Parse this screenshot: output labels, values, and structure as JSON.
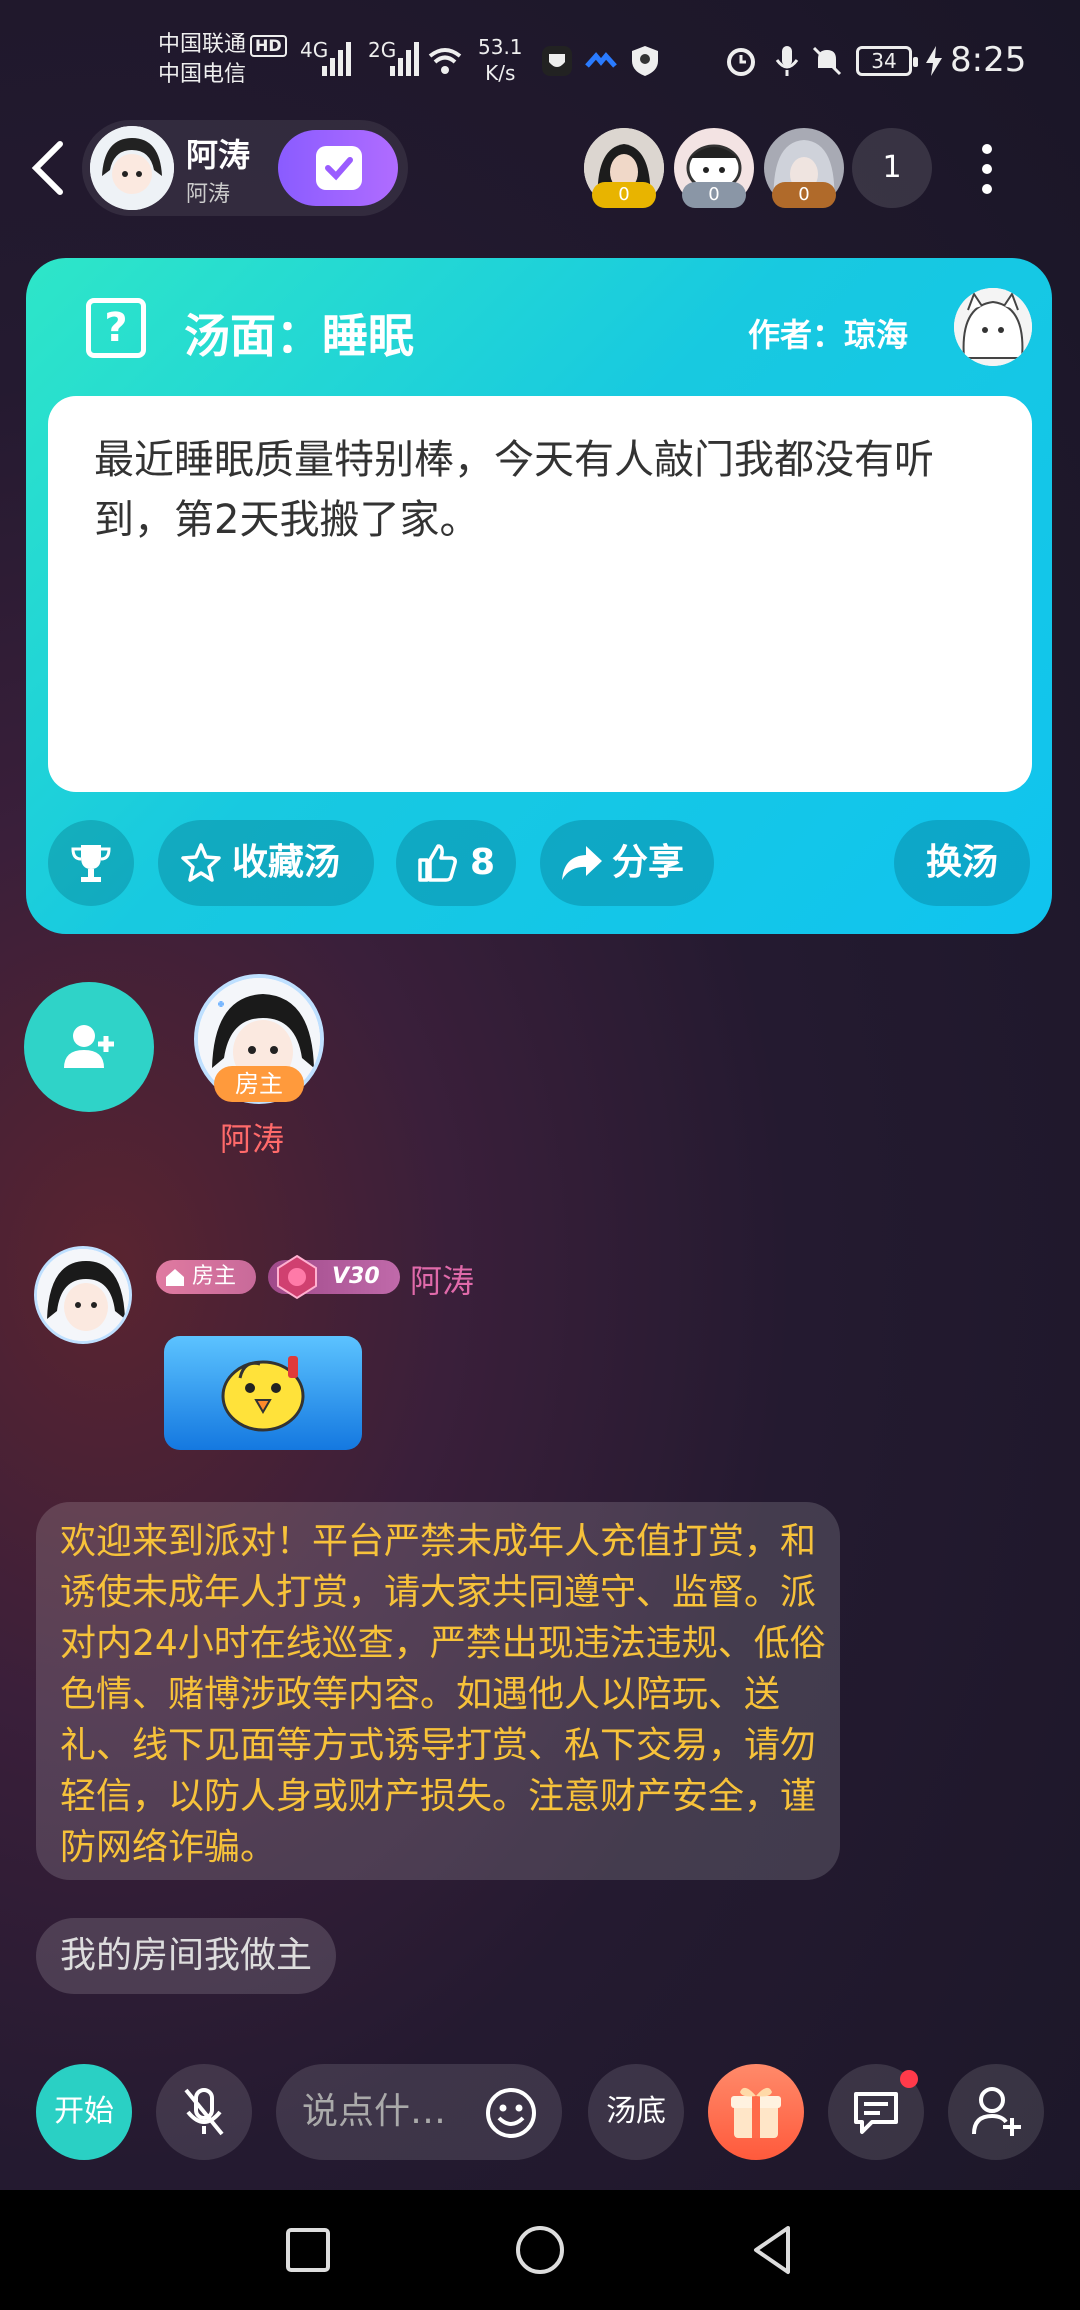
{
  "status_bar": {
    "carrier1": "中国联通",
    "carrier1_badge": "HD",
    "carrier2": "中国电信",
    "sig1": "4G",
    "sig2": "2G",
    "net_speed_value": "53.1",
    "net_speed_unit": "K/s",
    "battery": "34",
    "time": "8:25"
  },
  "header": {
    "host_name": "阿涛",
    "host_sub": "阿涛",
    "viewer_badges": [
      "0",
      "0",
      "0"
    ],
    "viewer_count": "1"
  },
  "soup_card": {
    "title": "汤面：睡眠",
    "author": "作者：琼海",
    "text": "最近睡眠质量特别棒，今天有人敲门我都没有听到，第2天我搬了家。",
    "collect_label": "收藏汤",
    "like_count": "8",
    "share_label": "分享",
    "change_label": "换汤"
  },
  "seats": {
    "host_tag": "房主",
    "host_name": "阿涛"
  },
  "chat": {
    "role_chip": "房主",
    "level_chip": "V30",
    "name": "阿涛",
    "notice": "欢迎来到派对！平台严禁未成年人充值打赏，和诱使未成年人打赏，请大家共同遵守、监督。派对内24小时在线巡查，严禁出现违法违规、低俗色情、赌博涉政等内容。如遇他人以陪玩、送礼、线下见面等方式诱导打赏、私下交易，请勿轻信，以防人身或财产损失。注意财产安全，谨防网络诈骗。",
    "room_tag": "我的房间我做主"
  },
  "bottom_bar": {
    "start_label": "开始",
    "input_placeholder": "说点什…",
    "answer_label": "汤底"
  },
  "colors": {
    "card_accent": "#18c9e0",
    "notice_text": "#f7c23a",
    "seat_name": "#ff6a6a",
    "start_button": "#2ad0c4"
  }
}
